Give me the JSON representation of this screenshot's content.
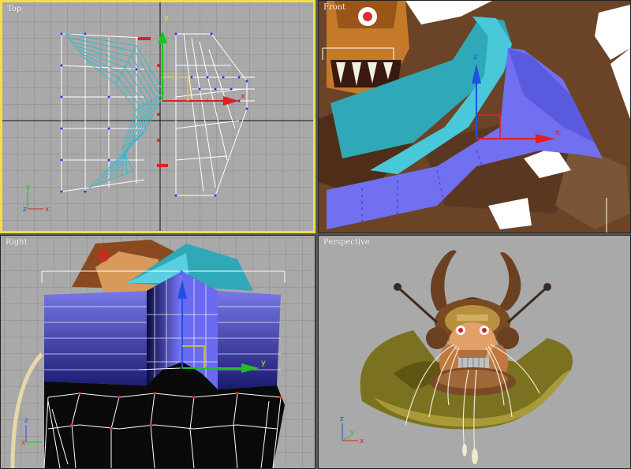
{
  "viewports": {
    "top": {
      "label": "Top",
      "active": true
    },
    "front": {
      "label": "Front",
      "active": false
    },
    "right": {
      "label": "Right",
      "active": false
    },
    "perspective": {
      "label": "Perspective",
      "active": false
    }
  },
  "axis_labels": {
    "x": "x",
    "y": "y",
    "z": "z"
  },
  "colors": {
    "viewport_bg": "#a9a9a9",
    "grid_line": "#8a8a8a",
    "grid_main": "#000000",
    "active_border": "#f0e040",
    "mesh_cyan": "#38b8c8",
    "mesh_blue": "#7070f0",
    "axis_x": "#e02020",
    "axis_y": "#20c020",
    "axis_z": "#2050e0"
  },
  "icons": [
    "transform-gizmo-icon",
    "axis-tripod-icon"
  ]
}
